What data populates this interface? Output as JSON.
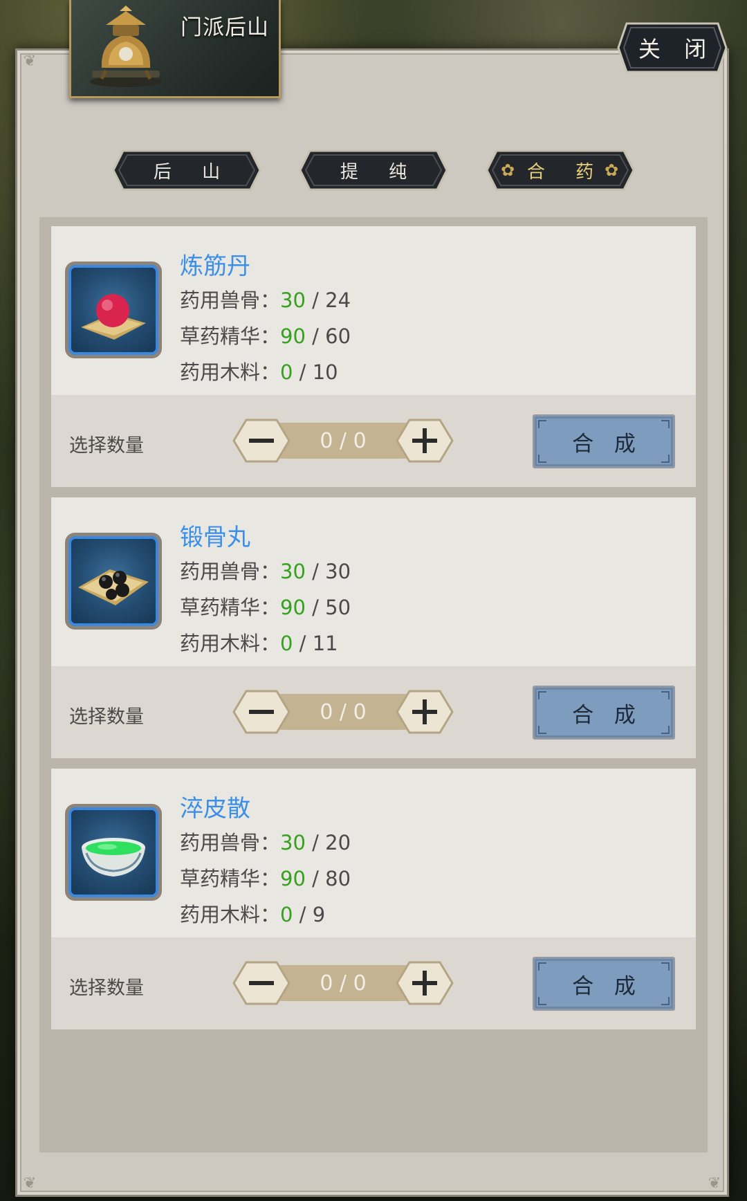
{
  "header": {
    "title": "门派后山",
    "close_label": "关 闭"
  },
  "tabs": [
    {
      "label": "后 山",
      "active": false
    },
    {
      "label": "提 纯",
      "active": false
    },
    {
      "label": "合 药",
      "active": true
    }
  ],
  "recipes": [
    {
      "name": "炼筋丹",
      "icon": "red-pill-icon",
      "requirements": [
        {
          "label": "药用兽骨：",
          "have": "30",
          "need": "24"
        },
        {
          "label": "草药精华：",
          "have": "90",
          "need": "60"
        },
        {
          "label": "药用木料：",
          "have": "0",
          "need": "10"
        }
      ],
      "quantity_label": "选择数量",
      "quantity": "0 / 0",
      "synth_label": "合 成"
    },
    {
      "name": "锻骨丸",
      "icon": "black-pills-icon",
      "requirements": [
        {
          "label": "药用兽骨：",
          "have": "30",
          "need": "30"
        },
        {
          "label": "草药精华：",
          "have": "90",
          "need": "50"
        },
        {
          "label": "药用木料：",
          "have": "0",
          "need": "11"
        }
      ],
      "quantity_label": "选择数量",
      "quantity": "0 / 0",
      "synth_label": "合 成"
    },
    {
      "name": "淬皮散",
      "icon": "green-powder-bowl-icon",
      "requirements": [
        {
          "label": "药用兽骨：",
          "have": "30",
          "need": "20"
        },
        {
          "label": "草药精华：",
          "have": "90",
          "need": "80"
        },
        {
          "label": "药用木料：",
          "have": "0",
          "need": "9"
        }
      ],
      "quantity_label": "选择数量",
      "quantity": "0 / 0",
      "synth_label": "合 成"
    }
  ],
  "colors": {
    "name": "#3b8fe6",
    "have": "#35a11e",
    "synth_button": "#7e9cbd",
    "active_tab_text": "#e8cf7a"
  }
}
